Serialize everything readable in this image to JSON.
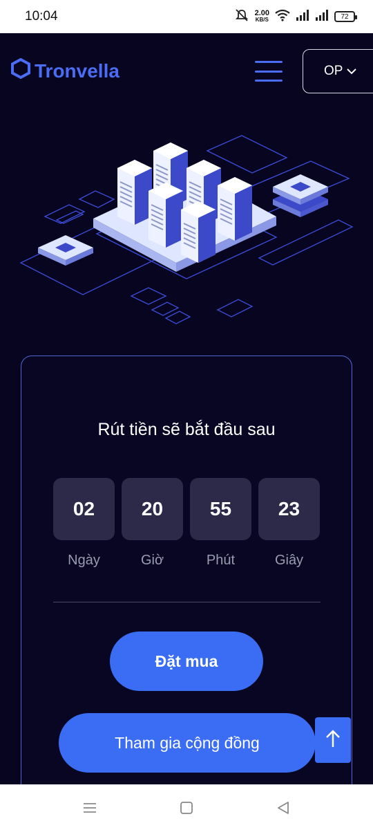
{
  "status_bar": {
    "time": "10:04",
    "speed_value": "2.00",
    "speed_unit": "KB/S",
    "battery": "72",
    "icons": [
      "mute-icon",
      "wifi-icon",
      "signal-icon",
      "signal-icon",
      "battery-icon"
    ]
  },
  "header": {
    "brand": "Tronvella",
    "menu_icon": "hamburger-icon",
    "language": "OP",
    "language_icon": "chevron-down-icon"
  },
  "countdown": {
    "title": "Rút tiền sẽ bắt đầu sau",
    "units": [
      {
        "value": "02",
        "label": "Ngày"
      },
      {
        "value": "20",
        "label": "Giờ"
      },
      {
        "value": "55",
        "label": "Phút"
      },
      {
        "value": "23",
        "label": "Giây"
      }
    ]
  },
  "actions": {
    "buy_label": "Đặt mua",
    "join_label": "Tham gia cộng đồng",
    "scroll_top_icon": "arrow-up-icon"
  },
  "navbar": {
    "icons": [
      "menu-icon",
      "home-icon",
      "back-icon"
    ]
  },
  "colors": {
    "background": "#07051f",
    "accent": "#3a6df3",
    "brand": "#4b6cf5",
    "card_border": "#5466d6",
    "timer_box": "#2c2a48"
  }
}
